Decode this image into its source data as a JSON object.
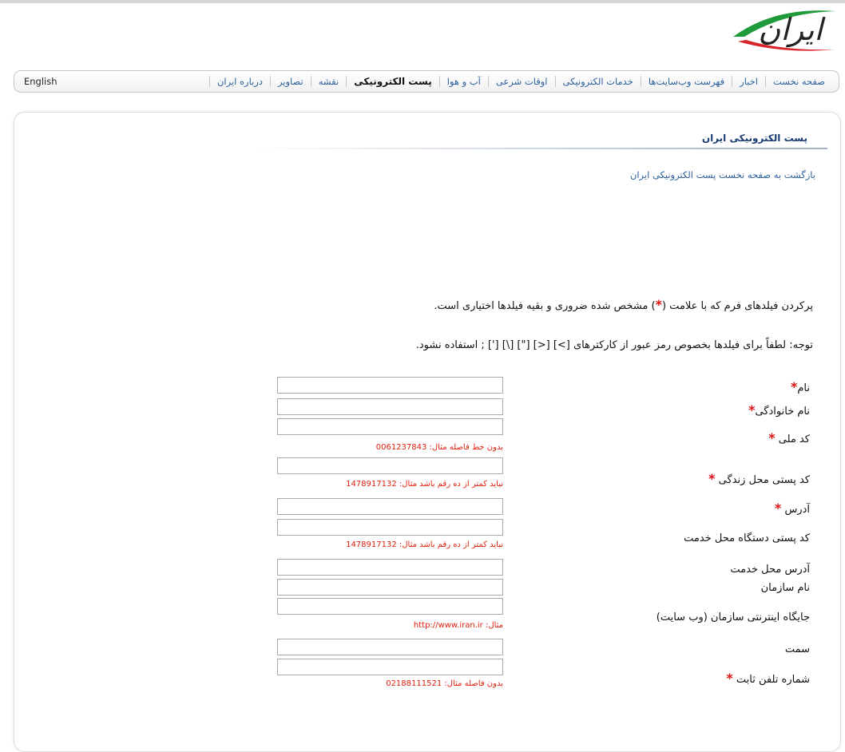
{
  "logo": {
    "text": "ایران"
  },
  "nav": {
    "items": [
      {
        "label": "صفحه نخست",
        "active": false
      },
      {
        "label": "اخبار",
        "active": false
      },
      {
        "label": "فهرست وب‌سایت‌ها",
        "active": false
      },
      {
        "label": "خدمات الکترونیکی",
        "active": false
      },
      {
        "label": "اوقات شرعی",
        "active": false
      },
      {
        "label": "آب و هوا",
        "active": false
      },
      {
        "label": "پست الکترونیکی",
        "active": true
      },
      {
        "label": "نقشه",
        "active": false
      },
      {
        "label": "تصاویر",
        "active": false
      },
      {
        "label": "درباره ایران",
        "active": false
      }
    ],
    "english": "English"
  },
  "page": {
    "title": "پست الکترونیکی ایران",
    "back_link": "بازگشت به صفحه نخست پست الکترونیکی ایران",
    "intro_before_star": "پرکردن فیلدهای فرم که با علامت (",
    "intro_star": "*",
    "intro_after_star": ") مشخص شده ضروری و بقیه فیلدها اختیاری است.",
    "note": "توجه: لطفاً برای فیلدها بخصوص رمز عبور از کارکترهای [>] [<] [\"] [\\] ['] ; استفاده نشود."
  },
  "form": {
    "required_mark": "*",
    "labels": {
      "first_name": "نام",
      "last_name": "نام خانوادگی",
      "national_code": "کد ملی",
      "home_postal": "کد پستی محل زندگی",
      "address": "آدرس",
      "work_postal": "کد پستی دستگاه محل خدمت",
      "work_address": "آدرس محل خدمت",
      "org_name": "نام سازمان",
      "org_website": "جایگاه اینترنتی سازمان (وب سایت)",
      "position": "سمت",
      "phone": "شماره تلفن ثابت"
    },
    "values": {
      "first_name": "",
      "last_name": "",
      "national_code": "",
      "home_postal": "",
      "address": "",
      "work_postal": "",
      "work_address": "",
      "org_name": "",
      "org_website": "",
      "position": "",
      "phone": ""
    },
    "hints": {
      "national_code": "بدون خط فاصله مثال: 0061237843",
      "home_postal": "نباید کمتر از ده رقم باشد مثال: 1478917132",
      "work_postal": "نباید کمتر از ده رقم باشد مثال: 1478917132",
      "org_website": "مثال: http://www.iran.ir",
      "phone": "بدون فاصله مثال: 02188111521"
    }
  }
}
